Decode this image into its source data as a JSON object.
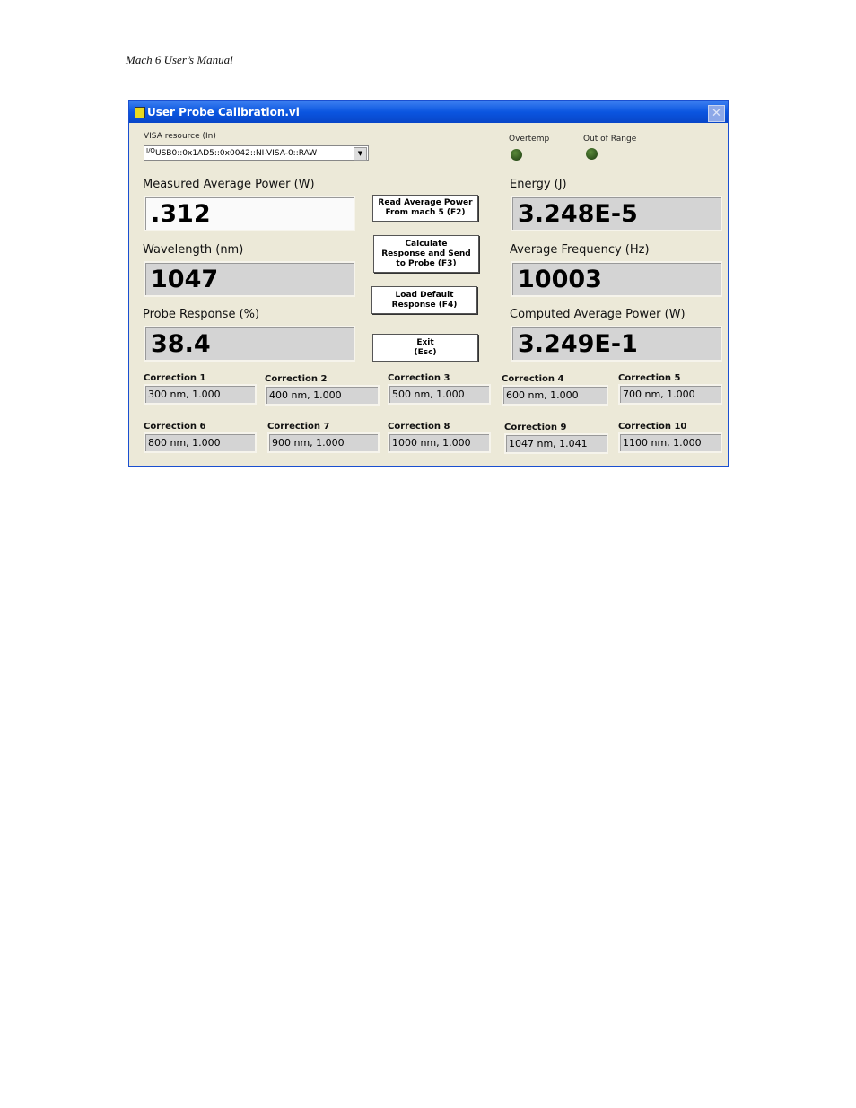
{
  "doc_header": "Mach 6 User’s Manual",
  "window": {
    "title": "User Probe Calibration.vi"
  },
  "visa": {
    "label": "VISA resource (In)",
    "value": "USB0::0x1AD5::0x0042::NI-VISA-0::RAW"
  },
  "leds": [
    {
      "label": "Overtemp",
      "on": false,
      "color": "#2a5018"
    },
    {
      "label": "Out of Range",
      "on": false,
      "color": "#2a5018"
    }
  ],
  "indicators": {
    "measured_power": {
      "label": "Measured Average Power (W)",
      "value": ".312"
    },
    "wavelength": {
      "label": "Wavelength (nm)",
      "value": "1047"
    },
    "probe_response": {
      "label": "Probe Response (%)",
      "value": "38.4"
    },
    "energy": {
      "label": "Energy (J)",
      "value": "3.248E-5"
    },
    "avg_frequency": {
      "label": "Average Frequency (Hz)",
      "value": "10003"
    },
    "computed_power": {
      "label": "Computed Average Power (W)",
      "value": "3.249E-1"
    }
  },
  "buttons": {
    "read": "Read Average Power\nFrom mach 5 (F2)",
    "calculate": "Calculate\nResponse and Send\nto Probe (F3)",
    "load": "Load Default\nResponse (F4)",
    "exit": "Exit\n(Esc)"
  },
  "corrections": [
    {
      "label": "Correction 1",
      "value": "300 nm,  1.000"
    },
    {
      "label": "Correction 2",
      "value": "400 nm,  1.000"
    },
    {
      "label": "Correction 3",
      "value": "500 nm,  1.000"
    },
    {
      "label": "Correction 4",
      "value": "600 nm,  1.000"
    },
    {
      "label": "Correction 5",
      "value": "700 nm,  1.000"
    },
    {
      "label": "Correction 6",
      "value": "800 nm,  1.000"
    },
    {
      "label": "Correction 7",
      "value": "900 nm,  1.000"
    },
    {
      "label": "Correction 8",
      "value": "1000 nm,  1.000"
    },
    {
      "label": "Correction 9",
      "value": "1047 nm,  1.041"
    },
    {
      "label": "Correction 10",
      "value": "1100 nm,  1.000"
    }
  ]
}
